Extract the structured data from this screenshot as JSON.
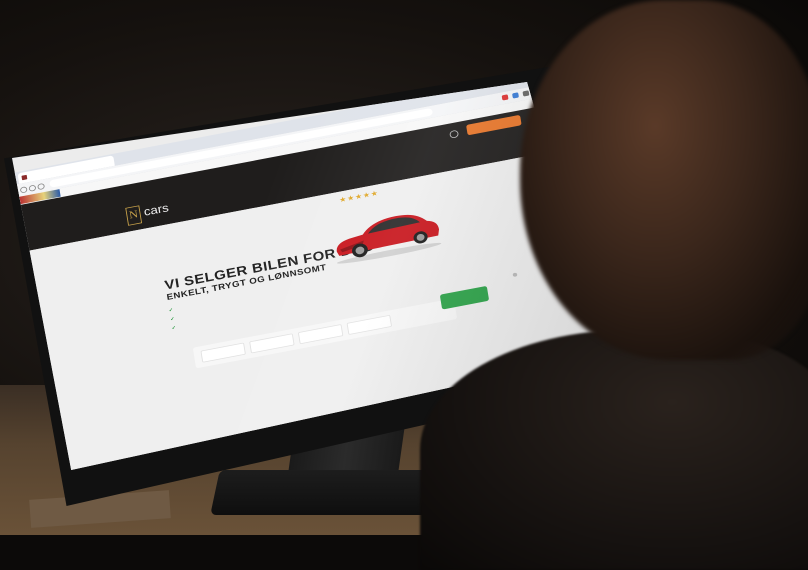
{
  "browser": {
    "tab_title": "",
    "url": ""
  },
  "bookmarks": {
    "logo": "",
    "link": ""
  },
  "site": {
    "promo": "",
    "top_cta": "",
    "logo_letter": "N",
    "logo_text": "cars",
    "nav": [
      "",
      "",
      "",
      ""
    ]
  },
  "hero": {
    "rating_stars": "★★★★★",
    "rating_value": 5,
    "rating_caption": "",
    "headline": "VI SELGER BILEN FOR DEG",
    "subheadline": "ENKELT, TRYGT OG LØNNSOMT",
    "bullets": [
      "",
      "",
      ""
    ],
    "form_fields": [
      "",
      "",
      "",
      ""
    ],
    "cta": "",
    "car_color": "#c8161d"
  },
  "colors": {
    "site_header": "#1f1d1c",
    "orange_cta": "#e8762a",
    "green_cta": "#2ea34a",
    "star": "#e0a82a"
  }
}
